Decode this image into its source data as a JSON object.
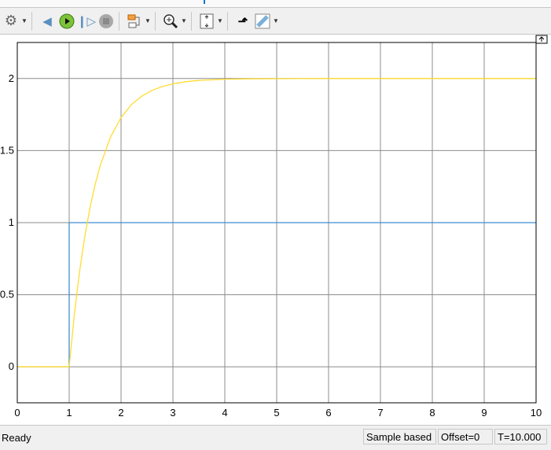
{
  "toolbar": {
    "icons": [
      "settings-gear-icon",
      "step-back-icon",
      "run-icon",
      "step-forward-icon",
      "stop-icon",
      "signal-selector-icon",
      "zoom-in-icon",
      "scale-axes-icon",
      "highlight-block-icon",
      "measurements-ruler-icon"
    ]
  },
  "colors": {
    "yellow_signal": "#ffdc33",
    "blue_signal": "#3f8fd2",
    "grid": "#8c8c8c",
    "run": "#4caf1a"
  },
  "chart_data": {
    "type": "line",
    "xlim": [
      0,
      10
    ],
    "ylim": [
      -0.25,
      2.25
    ],
    "grid": true,
    "xticks": [
      "0",
      "1",
      "2",
      "3",
      "4",
      "5",
      "6",
      "7",
      "8",
      "9",
      "10"
    ],
    "yticks": [
      "0",
      "0.5",
      "1",
      "1.5",
      "2"
    ],
    "series": [
      {
        "color": "#3f8fd2",
        "x": [
          0,
          1,
          1,
          10
        ],
        "y": [
          0,
          0,
          1,
          1
        ]
      },
      {
        "color": "#ffdc33",
        "x": [
          0,
          1,
          1.1,
          1.2,
          1.3,
          1.4,
          1.5,
          1.6,
          1.8,
          2,
          2.2,
          2.4,
          2.6,
          2.8,
          3,
          3.25,
          3.5,
          4,
          4.5,
          5,
          6,
          7,
          8,
          9,
          10
        ],
        "y": [
          0,
          0,
          0.363,
          0.659,
          0.902,
          1.101,
          1.264,
          1.398,
          1.596,
          1.729,
          1.819,
          1.878,
          1.918,
          1.945,
          1.963,
          1.978,
          1.987,
          1.995,
          1.998,
          1.999,
          2,
          2,
          2,
          2,
          2
        ]
      }
    ]
  },
  "status": {
    "ready": "Ready",
    "mode": "Sample based",
    "offset": "Offset=0",
    "time": "T=10.000"
  }
}
